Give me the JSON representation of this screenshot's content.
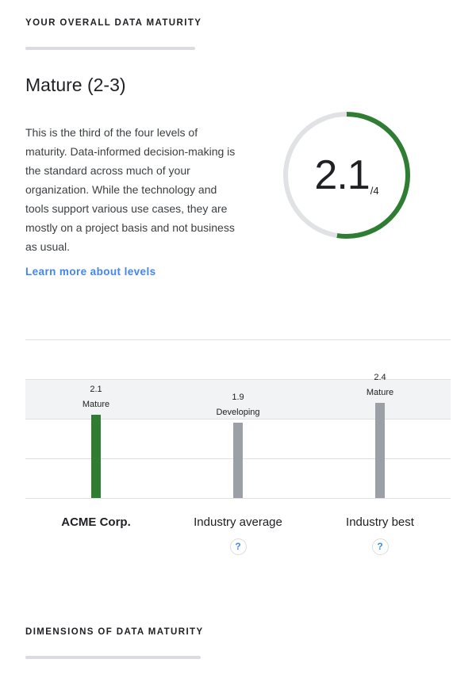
{
  "overall": {
    "heading": "YOUR OVERALL DATA MATURITY",
    "level_title": "Mature (2-3)",
    "description": "This is the third of the four levels of maturity. Data-informed decision-making is the standard across much of your organization. While the technology and tools support various use cases, they are mostly on a project basis and not business as usual.",
    "learn_more": "Learn more about levels",
    "score": {
      "value": 2.1,
      "display": "2.1",
      "max_display": "/4",
      "max": 4,
      "fill_fraction": 0.525
    }
  },
  "chart_data": {
    "type": "bar",
    "categories": [
      "ACME Corp.",
      "Industry average",
      "Industry best"
    ],
    "values": [
      2.1,
      1.9,
      2.4
    ],
    "value_labels": [
      "2.1",
      "1.9",
      "2.4"
    ],
    "level_labels": [
      "Mature",
      "Developing",
      "Mature"
    ],
    "title": "",
    "xlabel": "",
    "ylabel": "",
    "ylim": [
      0,
      4
    ],
    "bands": [
      {
        "from": 2,
        "to": 3,
        "color": "#f1f3f4"
      }
    ],
    "grid": true,
    "help_icons": [
      false,
      true,
      true
    ]
  },
  "dimensions": {
    "heading": "DIMENSIONS OF DATA MATURITY"
  },
  "colors": {
    "primary_green": "#2e7d32",
    "benchmark_gray": "#9aa0a6",
    "gauge_track": "#e1e2e6",
    "link_blue": "#4285f4",
    "band_gray": "#f1f3f4",
    "underline_gray": "#dadce0"
  },
  "icons": {
    "help": "question-mark-icon",
    "help_glyph": "?"
  }
}
